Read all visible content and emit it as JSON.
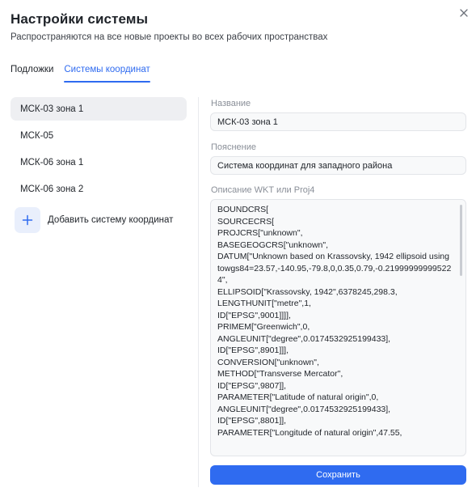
{
  "dialog": {
    "title": "Настройки системы",
    "subtitle": "Распространяются на все новые проекты во всех рабочих пространствах",
    "close_icon": "close-icon"
  },
  "tabs": [
    {
      "label": "Подложки",
      "active": false
    },
    {
      "label": "Системы координат",
      "active": true
    }
  ],
  "sidebar": {
    "items": [
      {
        "label": "МСК-03 зона 1",
        "selected": true
      },
      {
        "label": "МСК-05",
        "selected": false
      },
      {
        "label": "МСК-06 зона 1",
        "selected": false
      },
      {
        "label": "МСК-06 зона 2",
        "selected": false
      }
    ],
    "add_label": "Добавить систему координат",
    "add_icon": "plus-icon"
  },
  "form": {
    "name_label": "Название",
    "name_value": "МСК-03 зона 1",
    "description_label": "Пояснение",
    "description_value": "Система координат для западного района",
    "wkt_label": "Описание WKT или Proj4",
    "wkt_value": "BOUNDCRS[\nSOURCECRS[\nPROJCRS[\"unknown\",\nBASEGEOGCRS[\"unknown\",\nDATUM[\"Unknown based on Krassovsky, 1942 ellipsoid using towgs84=23.57,-140.95,-79.8,0,0.35,0.79,-0.219999999995224\",\nELLIPSOID[\"Krassovsky, 1942\",6378245,298.3,\nLENGTHUNIT[\"metre\",1,\nID[\"EPSG\",9001]]]],\nPRIMEM[\"Greenwich\",0,\nANGLEUNIT[\"degree\",0.0174532925199433],\nID[\"EPSG\",8901]]],\nCONVERSION[\"unknown\",\nMETHOD[\"Transverse Mercator\",\nID[\"EPSG\",9807]],\nPARAMETER[\"Latitude of natural origin\",0,\nANGLEUNIT[\"degree\",0.0174532925199433],\nID[\"EPSG\",8801]],\nPARAMETER[\"Longitude of natural origin\",47.55,",
    "save_label": "Сохранить"
  },
  "colors": {
    "accent": "#2f6bf0",
    "selected_bg": "#eeeff2",
    "add_bg": "#e9effc"
  }
}
